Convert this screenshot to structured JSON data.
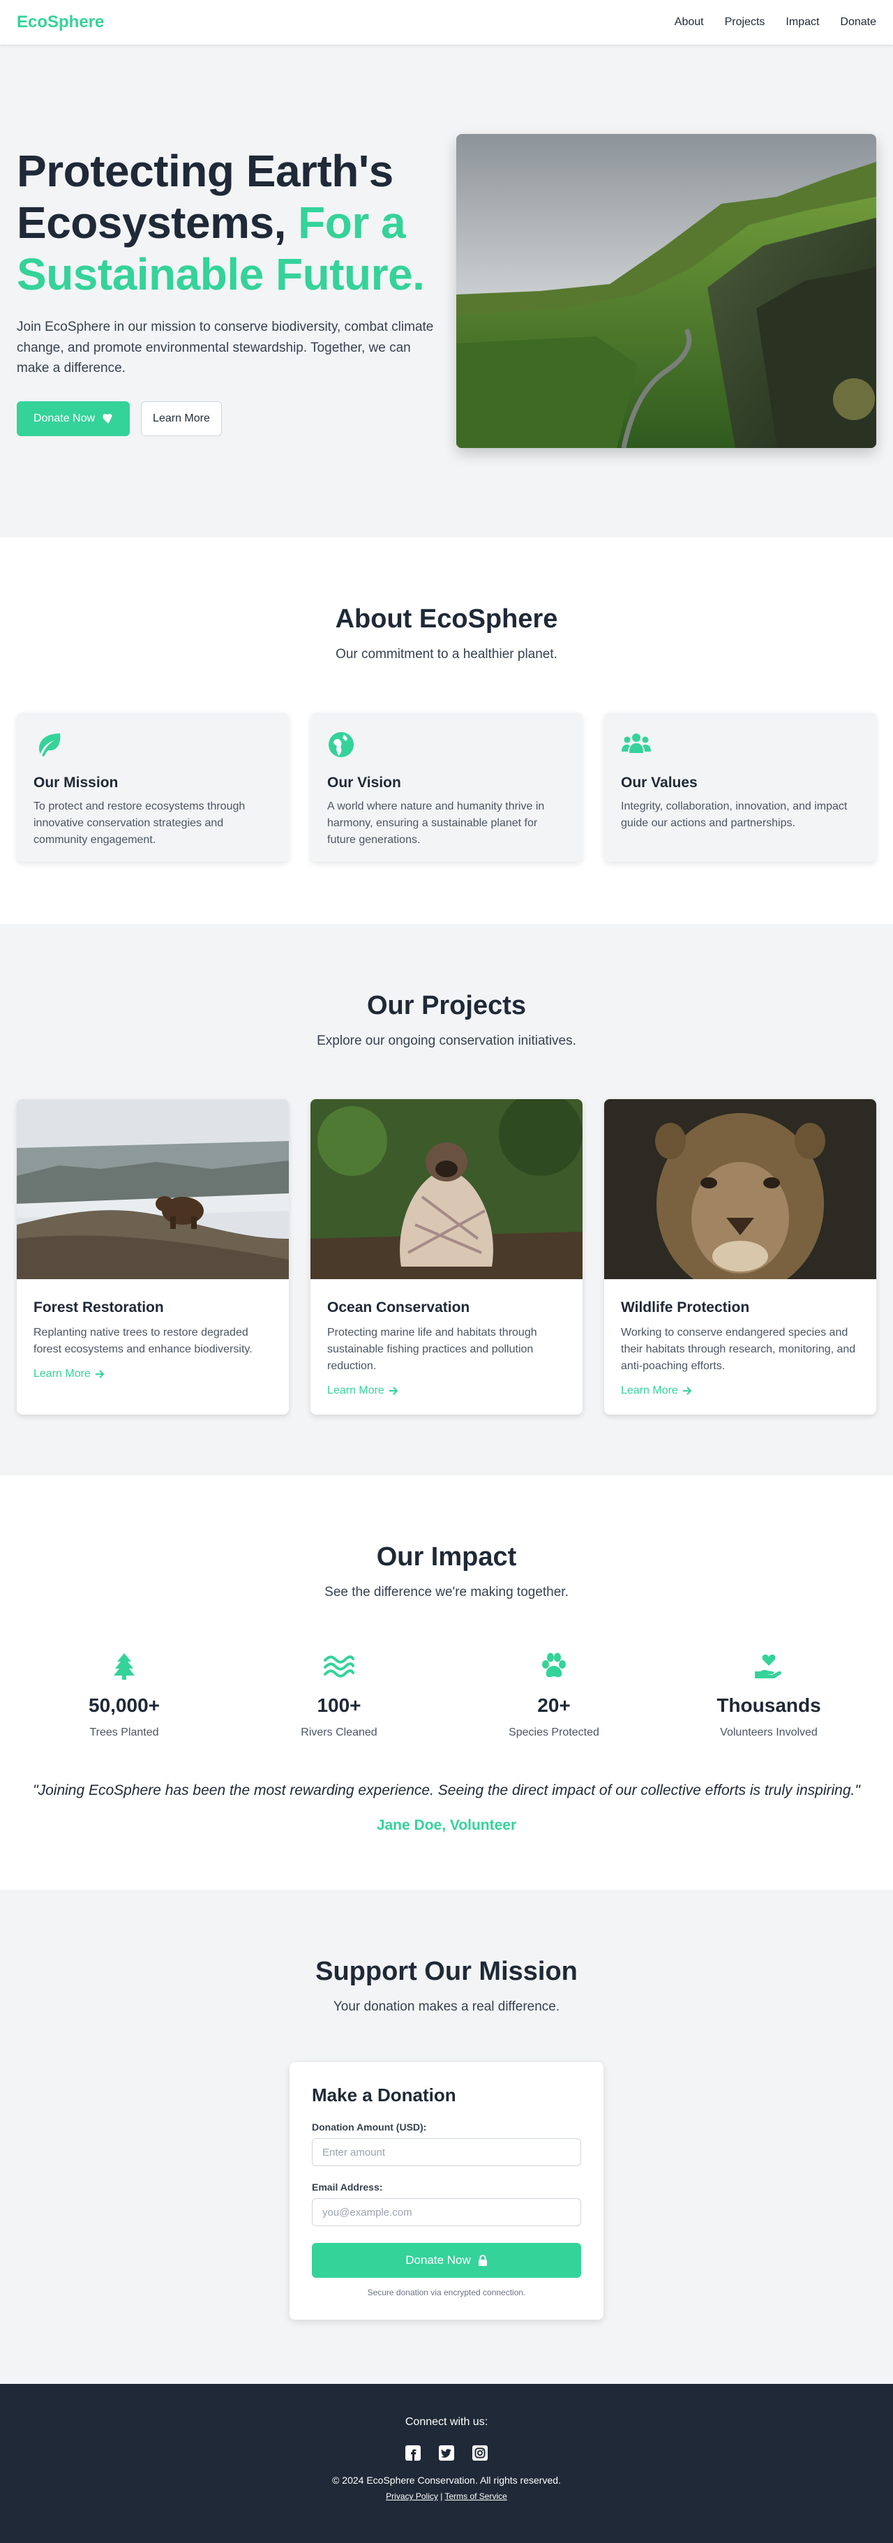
{
  "brand": {
    "logo": "EcoSphere",
    "accent_color": "#34d399",
    "dark_color": "#1f2937"
  },
  "nav": {
    "items": [
      "About",
      "Projects",
      "Impact",
      "Donate"
    ]
  },
  "hero": {
    "title_line1": "Protecting Earth's",
    "title_line2a": "Ecosystems,",
    "title_line2b": "For a",
    "title_line3": "Sustainable Future.",
    "description": "Join EcoSphere in our mission to conserve biodiversity, combat climate change, and promote environmental stewardship. Together, we can make a difference.",
    "donate_label": "Donate Now",
    "donate_icon": "heart-icon",
    "learn_label": "Learn More"
  },
  "about": {
    "title": "About EcoSphere",
    "subtitle": "Our commitment to a healthier planet.",
    "cards": [
      {
        "icon": "leaf-icon",
        "title": "Our Mission",
        "text": "To protect and restore ecosystems through innovative conservation strategies and community engagement."
      },
      {
        "icon": "globe-icon",
        "title": "Our Vision",
        "text": "A world where nature and humanity thrive in harmony, ensuring a sustainable planet for future generations."
      },
      {
        "icon": "users-icon",
        "title": "Our Values",
        "text": "Integrity, collaboration, innovation, and impact guide our actions and partnerships."
      }
    ]
  },
  "projects": {
    "title": "Our Projects",
    "subtitle": "Explore our ongoing conservation initiatives.",
    "cards": [
      {
        "title": "Forest Restoration",
        "text": "Replanting native trees to restore degraded forest ecosystems and enhance biodiversity.",
        "link": "Learn More"
      },
      {
        "title": "Ocean Conservation",
        "text": "Protecting marine life and habitats through sustainable fishing practices and pollution reduction.",
        "link": "Learn More"
      },
      {
        "title": "Wildlife Protection",
        "text": "Working to conserve endangered species and their habitats through research, monitoring, and anti-poaching efforts.",
        "link": "Learn More"
      }
    ]
  },
  "impact": {
    "title": "Our Impact",
    "subtitle": "See the difference we're making together.",
    "stats": [
      {
        "icon": "tree-icon",
        "value": "50,000+",
        "label": "Trees Planted"
      },
      {
        "icon": "water-icon",
        "value": "100+",
        "label": "Rivers Cleaned"
      },
      {
        "icon": "paw-icon",
        "value": "20+",
        "label": "Species Protected"
      },
      {
        "icon": "hand-heart-icon",
        "value": "Thousands",
        "label": "Volunteers Involved"
      }
    ],
    "quote": "\"Joining EcoSphere has been the most rewarding experience. Seeing the direct impact of our collective efforts is truly inspiring.\"",
    "quote_author": "Jane Doe, Volunteer"
  },
  "support": {
    "title": "Support Our Mission",
    "subtitle": "Your donation makes a real difference.",
    "form_title": "Make a Donation",
    "amount_label": "Donation Amount (USD):",
    "amount_placeholder": "Enter amount",
    "email_label": "Email Address:",
    "email_placeholder": "you@example.com",
    "submit_label": "Donate Now",
    "submit_icon": "lock-icon",
    "secure_note": "Secure donation via encrypted connection."
  },
  "footer": {
    "connect": "Connect with us:",
    "socials": [
      "facebook-icon",
      "twitter-icon",
      "instagram-icon"
    ],
    "copyright": "© 2024 EcoSphere Conservation. All rights reserved.",
    "privacy": "Privacy Policy",
    "separator": "|",
    "terms": "Terms of Service"
  }
}
